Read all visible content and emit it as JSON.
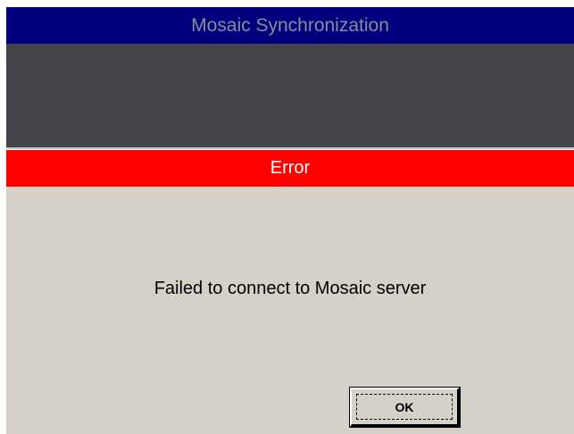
{
  "window": {
    "title": "Mosaic Synchronization"
  },
  "dialog": {
    "header": "Error",
    "message": "Failed to connect to Mosaic server",
    "ok_label": "OK"
  },
  "colors": {
    "title_bar": "#00007f",
    "dark_panel": "#45434a",
    "error_bar": "#ff0000",
    "body": "#d5d1c9"
  }
}
